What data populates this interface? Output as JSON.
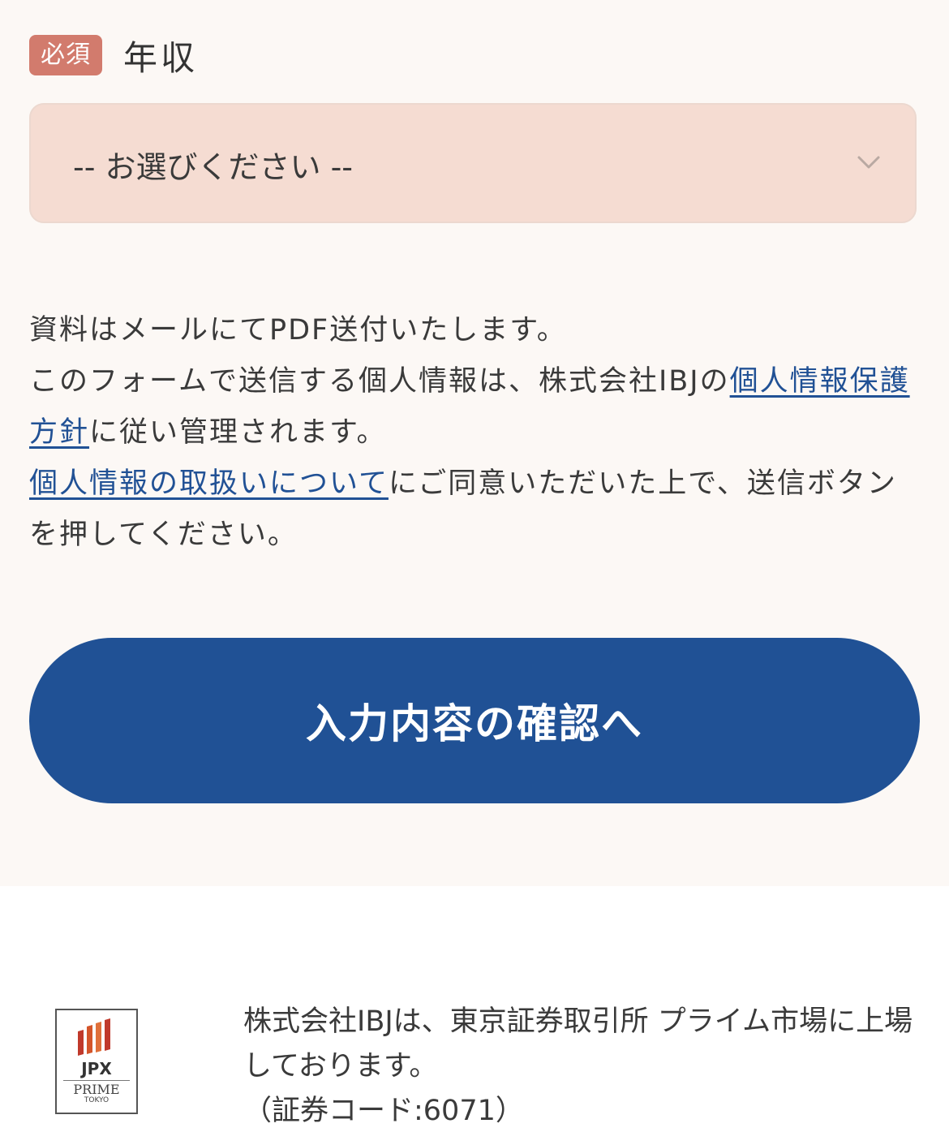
{
  "field": {
    "required_badge": "必須",
    "label": "年収",
    "select_value": "-- お選びください --"
  },
  "notice": {
    "line1": "資料はメールにてPDF送付いたします。",
    "line2_before": "このフォームで送信する個人情報は、株式会社IBJの",
    "privacy_policy_link": "個人情報保護方針",
    "line2_after": "に従い管理されます。",
    "handling_link": "個人情報の取扱いについて",
    "line3_after": "にご同意いただいた上で、送信ボタンを押してください。"
  },
  "confirm_button": "入力内容の確認へ",
  "footer": {
    "logo": {
      "jpx": "JPX",
      "prime": "PRIME",
      "tokyo": "TOKYO",
      "bar_colors": [
        "#c0392b",
        "#d4552a",
        "#e0703a",
        "#c0392b"
      ]
    },
    "listing_line1": "株式会社IBJは、東京証券取引所 プライム市場に上場しております。",
    "listing_line2": "（証券コード:6071）"
  },
  "colors": {
    "badge": "#d27b6d",
    "select_bg": "#f5dcd2",
    "link": "#215195",
    "button": "#205195",
    "form_bg": "#fcf8f5"
  }
}
